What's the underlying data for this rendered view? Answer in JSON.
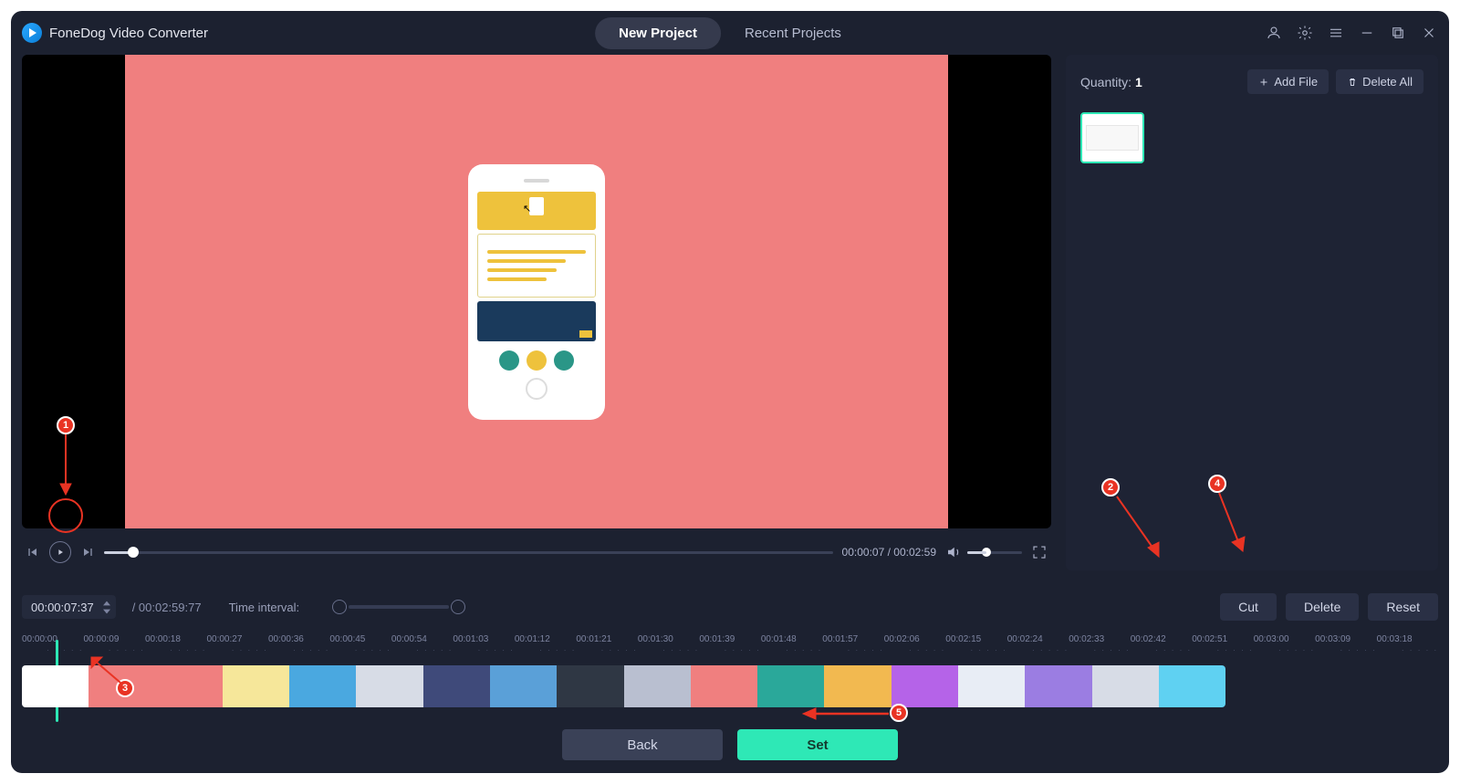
{
  "titlebar": {
    "app_name": "FoneDog Video Converter",
    "tab_new": "New Project",
    "tab_recent": "Recent Projects"
  },
  "sidebar": {
    "qty_label": "Quantity:",
    "qty_value": "1",
    "add_file": "Add File",
    "delete_all": "Delete All"
  },
  "player": {
    "time_current": "00:00:07",
    "time_total": "00:02:59"
  },
  "strip": {
    "time_position": "00:00:07:37",
    "duration": "/ 00:02:59:77",
    "ti_label": "Time interval:",
    "cut": "Cut",
    "del": "Delete",
    "reset": "Reset"
  },
  "ruler": [
    "00:00:00",
    "00:00:09",
    "00:00:18",
    "00:00:27",
    "00:00:36",
    "00:00:45",
    "00:00:54",
    "00:01:03",
    "00:01:12",
    "00:01:21",
    "00:01:30",
    "00:01:39",
    "00:01:48",
    "00:01:57",
    "00:02:06",
    "00:02:15",
    "00:02:24",
    "00:02:33",
    "00:02:42",
    "00:02:51",
    "00:03:00",
    "00:03:09",
    "00:03:18"
  ],
  "footer": {
    "back": "Back",
    "set": "Set"
  },
  "annotations": [
    "1",
    "2",
    "3",
    "4",
    "5"
  ],
  "clip_colors": [
    "#ffffff",
    "#f07f7f",
    "#f07f7f",
    "#f6e79a",
    "#4aa8e0",
    "#d7dce6",
    "#3f4a7a",
    "#5aa0d8",
    "#2f3744",
    "#b9bfd0",
    "#f07f7f",
    "#2aa89a",
    "#f2b950",
    "#b563e8",
    "#e8edf5",
    "#9b7de2",
    "#d7dce6",
    "#5fd1f2"
  ]
}
